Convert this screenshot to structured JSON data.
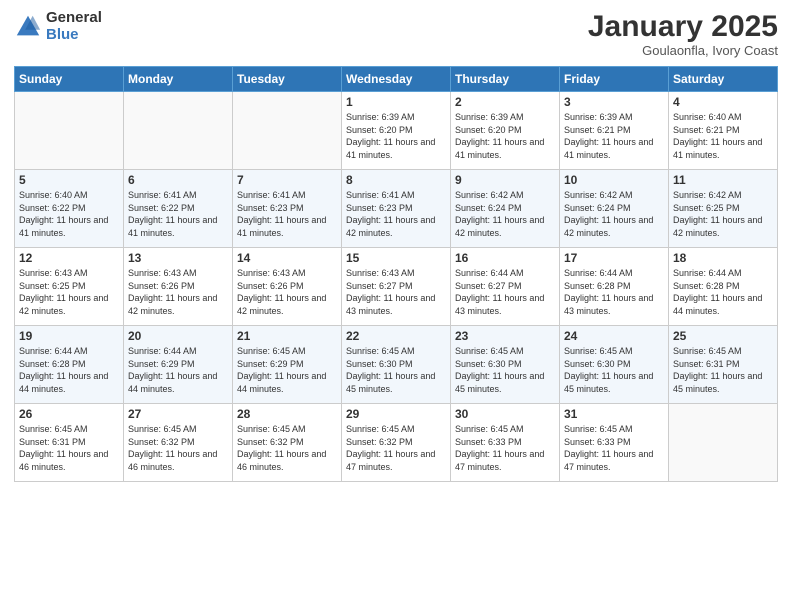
{
  "header": {
    "logo_general": "General",
    "logo_blue": "Blue",
    "month": "January 2025",
    "location": "Goulaonfla, Ivory Coast"
  },
  "days_of_week": [
    "Sunday",
    "Monday",
    "Tuesday",
    "Wednesday",
    "Thursday",
    "Friday",
    "Saturday"
  ],
  "weeks": [
    [
      {
        "day": "",
        "detail": ""
      },
      {
        "day": "",
        "detail": ""
      },
      {
        "day": "",
        "detail": ""
      },
      {
        "day": "1",
        "detail": "Sunrise: 6:39 AM\nSunset: 6:20 PM\nDaylight: 11 hours and 41 minutes."
      },
      {
        "day": "2",
        "detail": "Sunrise: 6:39 AM\nSunset: 6:20 PM\nDaylight: 11 hours and 41 minutes."
      },
      {
        "day": "3",
        "detail": "Sunrise: 6:39 AM\nSunset: 6:21 PM\nDaylight: 11 hours and 41 minutes."
      },
      {
        "day": "4",
        "detail": "Sunrise: 6:40 AM\nSunset: 6:21 PM\nDaylight: 11 hours and 41 minutes."
      }
    ],
    [
      {
        "day": "5",
        "detail": "Sunrise: 6:40 AM\nSunset: 6:22 PM\nDaylight: 11 hours and 41 minutes."
      },
      {
        "day": "6",
        "detail": "Sunrise: 6:41 AM\nSunset: 6:22 PM\nDaylight: 11 hours and 41 minutes."
      },
      {
        "day": "7",
        "detail": "Sunrise: 6:41 AM\nSunset: 6:23 PM\nDaylight: 11 hours and 41 minutes."
      },
      {
        "day": "8",
        "detail": "Sunrise: 6:41 AM\nSunset: 6:23 PM\nDaylight: 11 hours and 42 minutes."
      },
      {
        "day": "9",
        "detail": "Sunrise: 6:42 AM\nSunset: 6:24 PM\nDaylight: 11 hours and 42 minutes."
      },
      {
        "day": "10",
        "detail": "Sunrise: 6:42 AM\nSunset: 6:24 PM\nDaylight: 11 hours and 42 minutes."
      },
      {
        "day": "11",
        "detail": "Sunrise: 6:42 AM\nSunset: 6:25 PM\nDaylight: 11 hours and 42 minutes."
      }
    ],
    [
      {
        "day": "12",
        "detail": "Sunrise: 6:43 AM\nSunset: 6:25 PM\nDaylight: 11 hours and 42 minutes."
      },
      {
        "day": "13",
        "detail": "Sunrise: 6:43 AM\nSunset: 6:26 PM\nDaylight: 11 hours and 42 minutes."
      },
      {
        "day": "14",
        "detail": "Sunrise: 6:43 AM\nSunset: 6:26 PM\nDaylight: 11 hours and 42 minutes."
      },
      {
        "day": "15",
        "detail": "Sunrise: 6:43 AM\nSunset: 6:27 PM\nDaylight: 11 hours and 43 minutes."
      },
      {
        "day": "16",
        "detail": "Sunrise: 6:44 AM\nSunset: 6:27 PM\nDaylight: 11 hours and 43 minutes."
      },
      {
        "day": "17",
        "detail": "Sunrise: 6:44 AM\nSunset: 6:28 PM\nDaylight: 11 hours and 43 minutes."
      },
      {
        "day": "18",
        "detail": "Sunrise: 6:44 AM\nSunset: 6:28 PM\nDaylight: 11 hours and 44 minutes."
      }
    ],
    [
      {
        "day": "19",
        "detail": "Sunrise: 6:44 AM\nSunset: 6:28 PM\nDaylight: 11 hours and 44 minutes."
      },
      {
        "day": "20",
        "detail": "Sunrise: 6:44 AM\nSunset: 6:29 PM\nDaylight: 11 hours and 44 minutes."
      },
      {
        "day": "21",
        "detail": "Sunrise: 6:45 AM\nSunset: 6:29 PM\nDaylight: 11 hours and 44 minutes."
      },
      {
        "day": "22",
        "detail": "Sunrise: 6:45 AM\nSunset: 6:30 PM\nDaylight: 11 hours and 45 minutes."
      },
      {
        "day": "23",
        "detail": "Sunrise: 6:45 AM\nSunset: 6:30 PM\nDaylight: 11 hours and 45 minutes."
      },
      {
        "day": "24",
        "detail": "Sunrise: 6:45 AM\nSunset: 6:30 PM\nDaylight: 11 hours and 45 minutes."
      },
      {
        "day": "25",
        "detail": "Sunrise: 6:45 AM\nSunset: 6:31 PM\nDaylight: 11 hours and 45 minutes."
      }
    ],
    [
      {
        "day": "26",
        "detail": "Sunrise: 6:45 AM\nSunset: 6:31 PM\nDaylight: 11 hours and 46 minutes."
      },
      {
        "day": "27",
        "detail": "Sunrise: 6:45 AM\nSunset: 6:32 PM\nDaylight: 11 hours and 46 minutes."
      },
      {
        "day": "28",
        "detail": "Sunrise: 6:45 AM\nSunset: 6:32 PM\nDaylight: 11 hours and 46 minutes."
      },
      {
        "day": "29",
        "detail": "Sunrise: 6:45 AM\nSunset: 6:32 PM\nDaylight: 11 hours and 47 minutes."
      },
      {
        "day": "30",
        "detail": "Sunrise: 6:45 AM\nSunset: 6:33 PM\nDaylight: 11 hours and 47 minutes."
      },
      {
        "day": "31",
        "detail": "Sunrise: 6:45 AM\nSunset: 6:33 PM\nDaylight: 11 hours and 47 minutes."
      },
      {
        "day": "",
        "detail": ""
      }
    ]
  ]
}
